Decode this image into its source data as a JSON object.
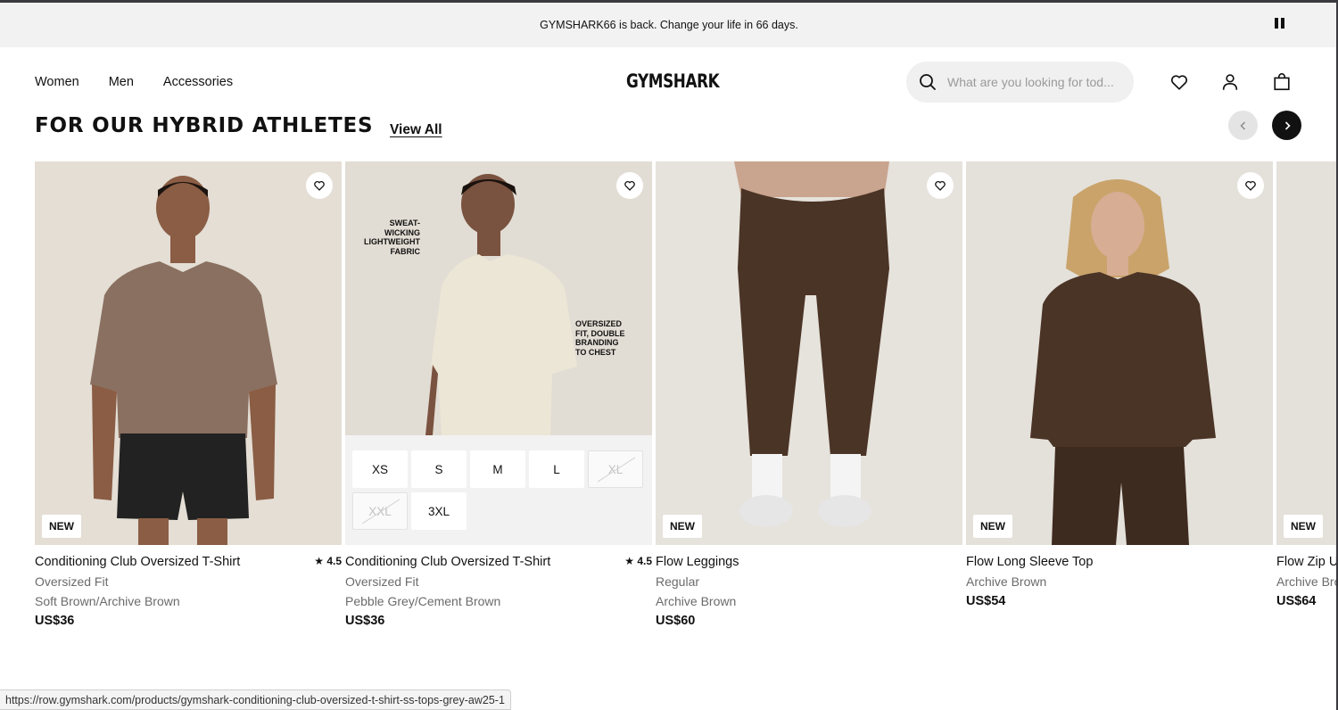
{
  "announcement": {
    "text": "GYMSHARK66 is back. Change your life in 66 days."
  },
  "header": {
    "nav": [
      "Women",
      "Men",
      "Accessories"
    ],
    "logo": "GYMSHARK",
    "search_placeholder": "What are you looking for tod..."
  },
  "section": {
    "title": "FOR OUR HYBRID ATHLETES",
    "view_all": "View All"
  },
  "products": [
    {
      "name": "Conditioning Club Oversized T-Shirt",
      "fit": "Oversized Fit",
      "color": "Soft Brown/Archive Brown",
      "price": "US$36",
      "rating": "4.5",
      "badge": "NEW"
    },
    {
      "name": "Conditioning Club Oversized T-Shirt",
      "fit": "Oversized Fit",
      "color": "Pebble Grey/Cement Brown",
      "price": "US$36",
      "rating": "4.5",
      "callout_1": "SWEAT-\nWICKING\nLIGHTWEIGHT\nFABRIC",
      "callout_2": "OVERSIZED\nFIT, DOUBLE\nBRANDING\nTO CHEST",
      "sizes": [
        {
          "label": "XS",
          "available": true
        },
        {
          "label": "S",
          "available": true
        },
        {
          "label": "M",
          "available": true
        },
        {
          "label": "L",
          "available": true
        },
        {
          "label": "XL",
          "available": false
        },
        {
          "label": "XXL",
          "available": false
        },
        {
          "label": "3XL",
          "available": true
        }
      ]
    },
    {
      "name": "Flow Leggings",
      "fit": "Regular",
      "color": "Archive Brown",
      "price": "US$60",
      "badge": "NEW"
    },
    {
      "name": "Flow Long Sleeve Top",
      "color": "Archive Brown",
      "price": "US$54",
      "badge": "NEW"
    },
    {
      "name": "Flow Zip Up",
      "color": "Archive Brown",
      "price": "US$64",
      "badge": "NEW"
    }
  ],
  "status_url": "https://row.gymshark.com/products/gymshark-conditioning-club-oversized-t-shirt-ss-tops-grey-aw25-1",
  "icons": [
    "pause-icon",
    "search-icon",
    "heart-icon",
    "account-icon",
    "bag-icon",
    "chevron-left-icon",
    "chevron-right-icon",
    "star-icon"
  ],
  "colors": {
    "accent": "#111111",
    "announce_bg": "#f2f2f2",
    "photo_bg": "#e8e3dc",
    "brown": "#4a3426"
  }
}
